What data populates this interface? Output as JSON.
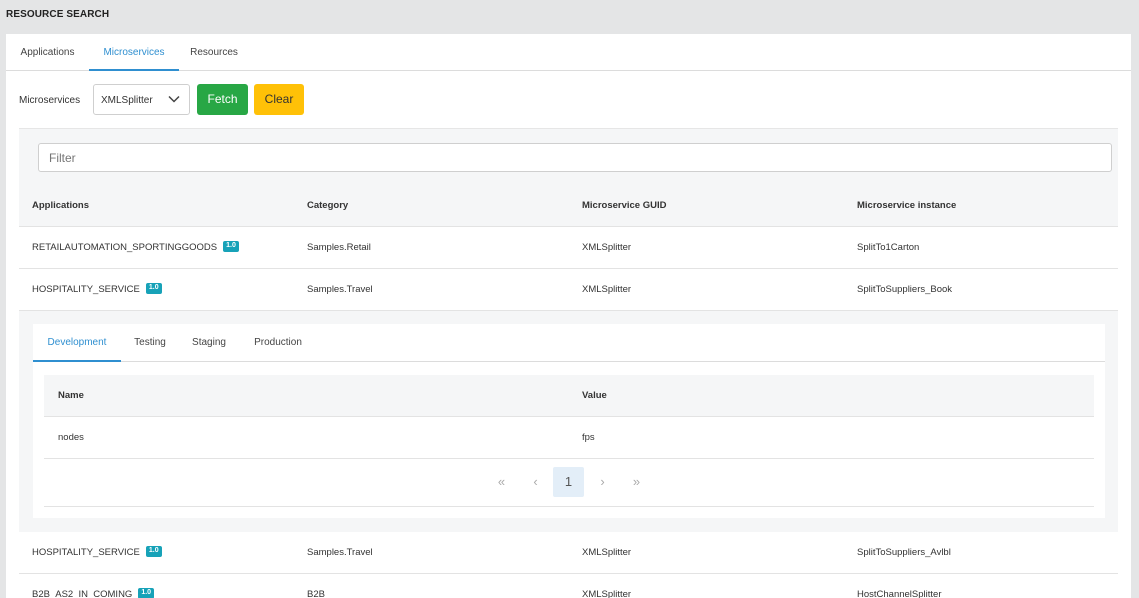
{
  "page_title": "RESOURCE SEARCH",
  "tabs": [
    {
      "label": "Applications"
    },
    {
      "label": "Microservices"
    },
    {
      "label": "Resources"
    }
  ],
  "form": {
    "label": "Microservices",
    "select_value": "XMLSplitter",
    "fetch_label": "Fetch",
    "clear_label": "Clear"
  },
  "filter": {
    "placeholder": "Filter"
  },
  "table": {
    "headers": [
      "Applications",
      "Category",
      "Microservice GUID",
      "Microservice instance"
    ],
    "rows": [
      {
        "app": "RETAILAUTOMATION_SPORTINGGOODS",
        "version": "1.0",
        "category": "Samples.Retail",
        "guid": "XMLSplitter",
        "instance": "SplitTo1Carton"
      },
      {
        "app": "HOSPITALITY_SERVICE",
        "version": "1.0",
        "category": "Samples.Travel",
        "guid": "XMLSplitter",
        "instance": "SplitToSuppliers_Book"
      },
      {
        "app": "HOSPITALITY_SERVICE",
        "version": "1.0",
        "category": "Samples.Travel",
        "guid": "XMLSplitter",
        "instance": "SplitToSuppliers_Avlbl"
      },
      {
        "app": "B2B_AS2_IN_COMING",
        "version": "1.0",
        "category": "B2B",
        "guid": "XMLSplitter",
        "instance": "HostChannelSplitter"
      }
    ]
  },
  "detail": {
    "tabs": [
      {
        "label": "Development"
      },
      {
        "label": "Testing"
      },
      {
        "label": "Staging"
      },
      {
        "label": "Production"
      }
    ],
    "headers": [
      "Name",
      "Value"
    ],
    "rows": [
      {
        "name": "nodes",
        "value": "fps"
      }
    ],
    "pager": {
      "first": "«",
      "prev": "‹",
      "current": "1",
      "next": "›",
      "last": "»"
    }
  },
  "colors": {
    "accent": "#2f8fd0",
    "fetch": "#28a745",
    "clear": "#ffc107",
    "badge": "#17a2b8"
  }
}
